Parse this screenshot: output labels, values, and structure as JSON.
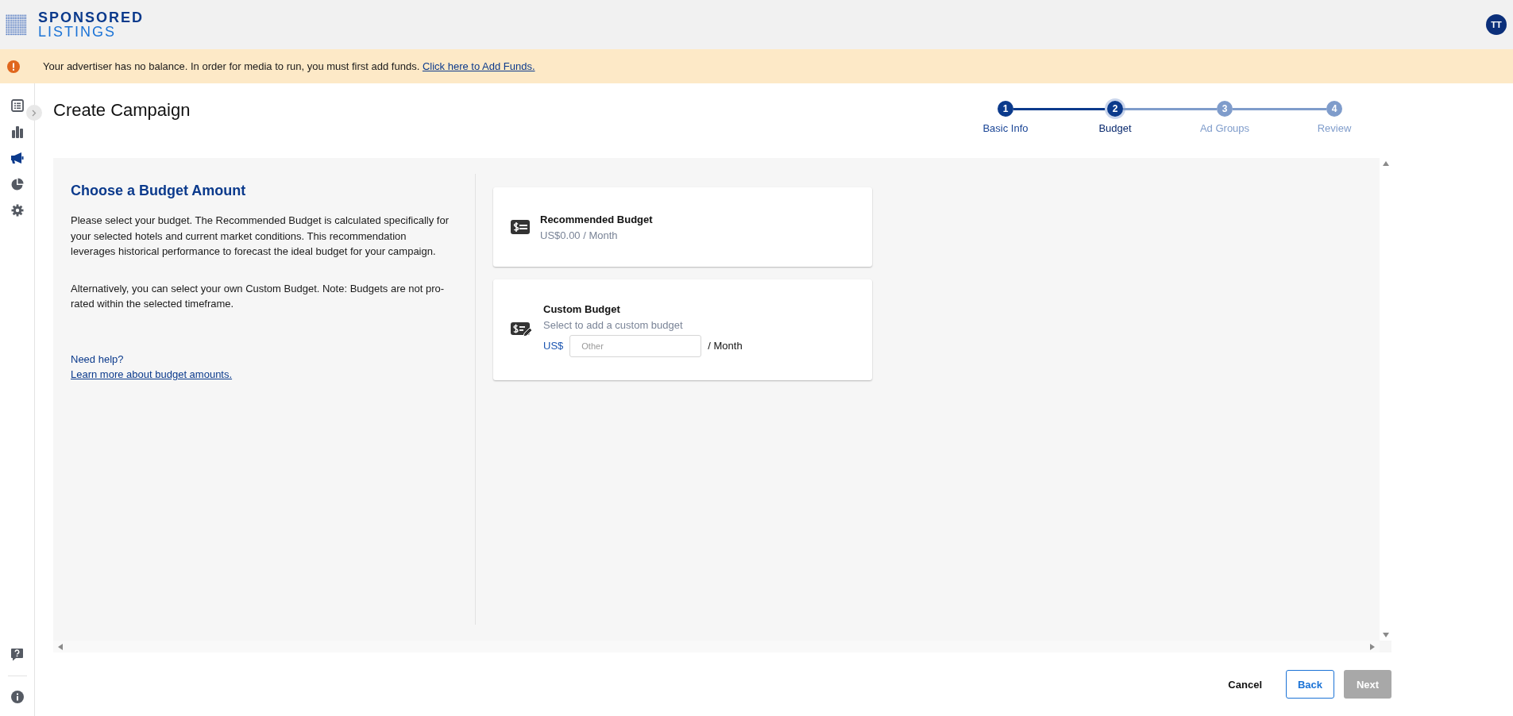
{
  "header": {
    "logo_top": "SPONSORED",
    "logo_bottom": "LISTINGS",
    "avatar": "TT"
  },
  "alert": {
    "message": "Your advertiser has no balance. In order for media to run, you must first add funds.",
    "link": "Click here to Add Funds."
  },
  "sidebar": {
    "items": [
      {
        "selected": false
      },
      {
        "selected": false
      },
      {
        "selected": true
      },
      {
        "selected": false
      },
      {
        "selected": false
      }
    ]
  },
  "page": {
    "title": "Create Campaign"
  },
  "stepper": {
    "steps": [
      {
        "number": "1",
        "label": "Basic Info",
        "completed": true,
        "selected": false
      },
      {
        "number": "2",
        "label": "Budget",
        "completed": false,
        "selected": true
      },
      {
        "number": "3",
        "label": "Ad Groups",
        "completed": false,
        "selected": false
      },
      {
        "number": "4",
        "label": "Review",
        "completed": false,
        "selected": false
      }
    ]
  },
  "budget": {
    "heading": "Choose a Budget Amount",
    "paragraphs": [
      "Please select your budget. The Recommended Budget is calculated specifically for your selected hotels and current market conditions. This recommendation leverages historical performance to forecast the ideal budget for your campaign.",
      "Alternatively, you can select your own Custom Budget. Note: Budgets are not pro-rated within the selected timeframe."
    ],
    "help_text": "Need help?",
    "help_link": "Learn more about budget amounts.",
    "options": [
      {
        "kind": "recommended",
        "title": "Recommended Budget",
        "detail": "US$0.00 / Month"
      },
      {
        "kind": "custom",
        "title": "Custom Budget",
        "detail": "Select to add a custom budget",
        "currency": "US$",
        "placeholder": "Other",
        "period": "/ Month"
      }
    ]
  },
  "footer": {
    "buttons": [
      {
        "kind": "text",
        "label": "Cancel",
        "disabled": false
      },
      {
        "kind": "outline",
        "label": "Back",
        "disabled": false
      },
      {
        "kind": "filled",
        "label": "Next",
        "disabled": true
      }
    ]
  }
}
